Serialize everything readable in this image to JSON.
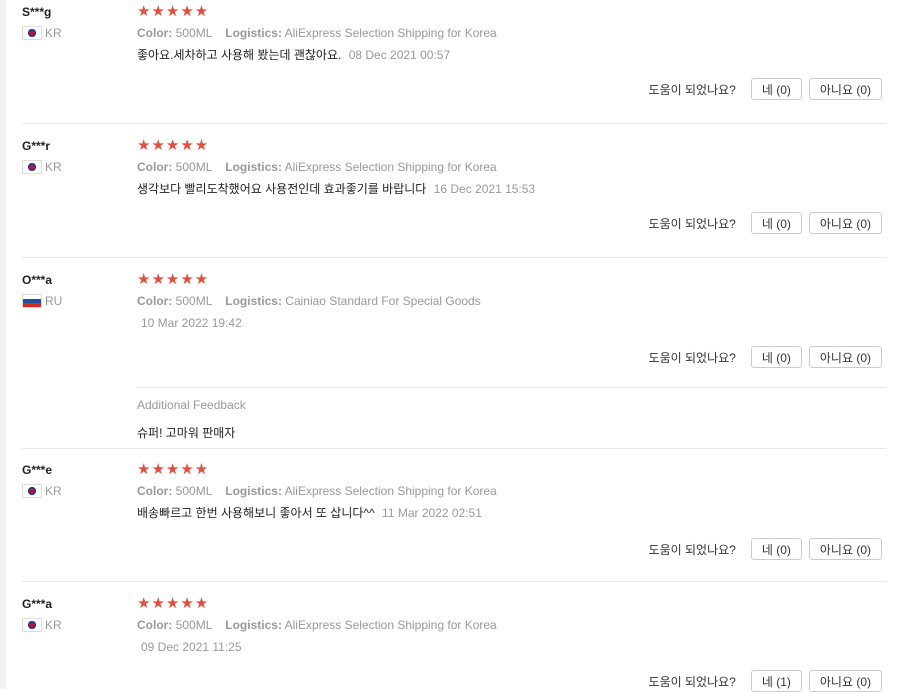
{
  "helpful_question": "도움이 되었나요?",
  "star_glyphs": "★★★★★",
  "labels": {
    "color": "Color:",
    "logistics": "Logistics:"
  },
  "colors": {
    "star": "#e74c3c",
    "muted": "#999999",
    "text": "#222222",
    "border": "#cccccc"
  },
  "reviews": [
    {
      "name": "S***g",
      "country": "KR",
      "rating": 5,
      "color": "500ML",
      "logistics": "AliExpress Selection Shipping for Korea",
      "text": "좋아요.세차하고 사용해 봤는데 괜찮아요.",
      "date": "08 Dec 2021 00:57",
      "yes": "네 (0)",
      "no": "아니요 (0)"
    },
    {
      "name": "G***r",
      "country": "KR",
      "rating": 5,
      "color": "500ML",
      "logistics": "AliExpress Selection Shipping for Korea",
      "text": "생각보다 빨리도착했어요 사용전인데 효과좋기를 바랍니다",
      "date": "16 Dec 2021 15:53",
      "yes": "네 (0)",
      "no": "아니요 (0)"
    },
    {
      "name": "O***a",
      "country": "RU",
      "rating": 5,
      "color": "500ML",
      "logistics": "Cainiao Standard For Special Goods",
      "text": "",
      "date": "10 Mar 2022 19:42",
      "yes": "네 (0)",
      "no": "아니요 (0)",
      "additional_feedback": {
        "title": "Additional Feedback",
        "text": "슈퍼! 고마워 판매자"
      }
    },
    {
      "name": "G***e",
      "country": "KR",
      "rating": 5,
      "color": "500ML",
      "logistics": "AliExpress Selection Shipping for Korea",
      "text": "배송빠르고 한번 사용해보니 좋아서 또 삽니다^^",
      "date": "11 Mar 2022 02:51",
      "yes": "네 (0)",
      "no": "아니요 (0)"
    },
    {
      "name": "G***a",
      "country": "KR",
      "rating": 5,
      "color": "500ML",
      "logistics": "AliExpress Selection Shipping for Korea",
      "text": "",
      "date": "09 Dec 2021 11:25",
      "yes": "네 (1)",
      "no": "아니요 (0)"
    }
  ]
}
